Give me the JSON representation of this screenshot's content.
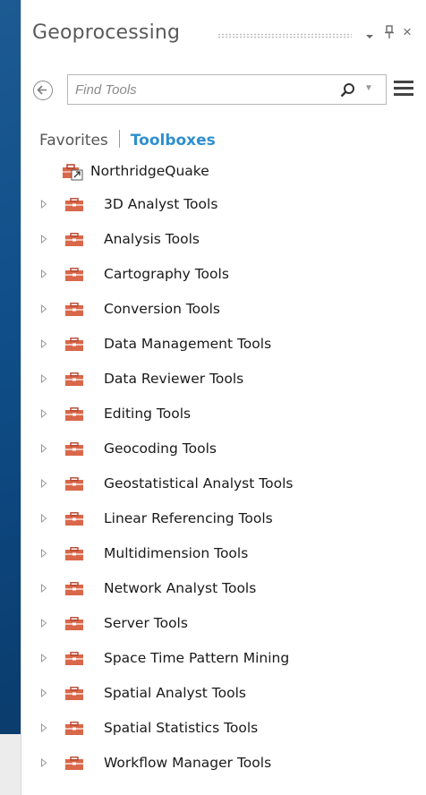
{
  "pane": {
    "title": "Geoprocessing",
    "dropdown_glyph": "▾",
    "pin_glyph": "⊥",
    "close_glyph": "×"
  },
  "search": {
    "placeholder": "Find Tools",
    "value": ""
  },
  "tabs": {
    "favorites": "Favorites",
    "toolboxes": "Toolboxes"
  },
  "project_toolbox": {
    "label": "NorthridgeQuake",
    "icon": "project-toolbox-icon"
  },
  "toolboxes": [
    {
      "label": "3D Analyst Tools"
    },
    {
      "label": "Analysis Tools"
    },
    {
      "label": "Cartography Tools"
    },
    {
      "label": "Conversion Tools"
    },
    {
      "label": "Data Management Tools"
    },
    {
      "label": "Data Reviewer Tools"
    },
    {
      "label": "Editing Tools"
    },
    {
      "label": "Geocoding Tools"
    },
    {
      "label": "Geostatistical Analyst Tools"
    },
    {
      "label": "Linear Referencing Tools"
    },
    {
      "label": "Multidimension Tools"
    },
    {
      "label": "Network Analyst Tools"
    },
    {
      "label": "Server Tools"
    },
    {
      "label": "Space Time Pattern Mining"
    },
    {
      "label": "Spatial Analyst Tools"
    },
    {
      "label": "Spatial Statistics Tools"
    },
    {
      "label": "Workflow Manager Tools"
    }
  ],
  "colors": {
    "accent": "#2f8fce",
    "toolbox_icon": "#d9674a",
    "background": "#0f4e89"
  }
}
